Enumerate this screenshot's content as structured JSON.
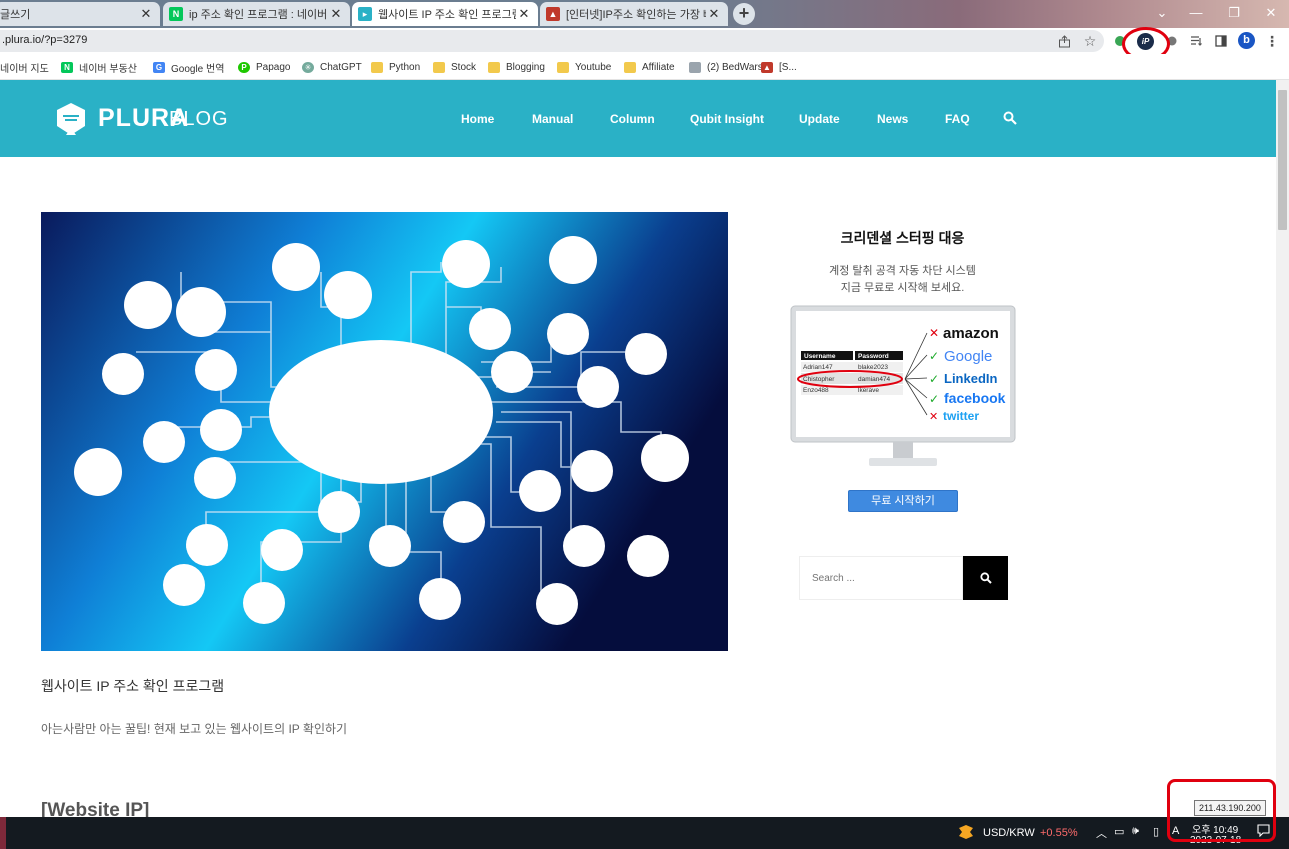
{
  "browser": {
    "tabs": [
      {
        "label": "글쓰기",
        "active": false
      },
      {
        "label": "ip 주소 확인 프로그램 : 네이버 블",
        "active": false
      },
      {
        "label": "웹사이트 IP 주소 확인 프로그램",
        "active": true
      },
      {
        "label": "[인터넷]IP주소 확인하는 가장 빠",
        "active": false
      }
    ],
    "new_tab": "+",
    "url": ".plura.io/?p=3279",
    "profile_initial": "b",
    "ip_extension_label": "iP",
    "bookmarks": [
      "네이버 지도",
      "네이버 부동산",
      "Google 번역",
      "Papago",
      "ChatGPT",
      "Python",
      "Stock",
      "Blogging",
      "Youtube",
      "Affiliate",
      "(2) BedWars",
      "[S..."
    ]
  },
  "site": {
    "logo_text": "PLURA",
    "logo_blog": "BLOG",
    "nav": [
      "Home",
      "Manual",
      "Column",
      "Qubit Insight",
      "Update",
      "News",
      "FAQ"
    ]
  },
  "post": {
    "title": "웹사이트 IP 주소 확인 프로그램",
    "excerpt": "아는사람만 아는 꿀팁! 현재 보고 있는 웹사이트의 IP 확인하기",
    "section_heading": "[Website IP]"
  },
  "sidebar": {
    "ad": {
      "title": "크리덴셜 스터핑 대응",
      "line1": "계정 탈취 공격 자동 차단 시스템",
      "line2": "지금 무료로 시작해 보세요.",
      "cta": "무료 시작하기",
      "table_headers": [
        "Username",
        "Password"
      ],
      "table_rows": [
        [
          "Adrian147",
          "blake2023"
        ],
        [
          "Chistopher",
          "damian474"
        ],
        [
          "Enzo488",
          "lkerave"
        ]
      ],
      "brands": [
        "amazon",
        "Google",
        "LinkedIn",
        "facebook",
        "twitter"
      ],
      "brand_status": [
        "x",
        "check",
        "check",
        "check",
        "x"
      ]
    },
    "search": {
      "placeholder": "Search ..."
    }
  },
  "taskbar": {
    "forex_pair": "USD/KRW",
    "forex_change": "+0.55%",
    "ime": "A",
    "clock_time": "오후 10:49",
    "clock_date": "2023-07-18",
    "ip_tooltip": "211.43.190.200"
  },
  "colors": {
    "header": "#2ab1c6",
    "cta": "#3f8ae0",
    "highlight_ring": "#e0000f",
    "forex_up": "#ff6b6b"
  }
}
